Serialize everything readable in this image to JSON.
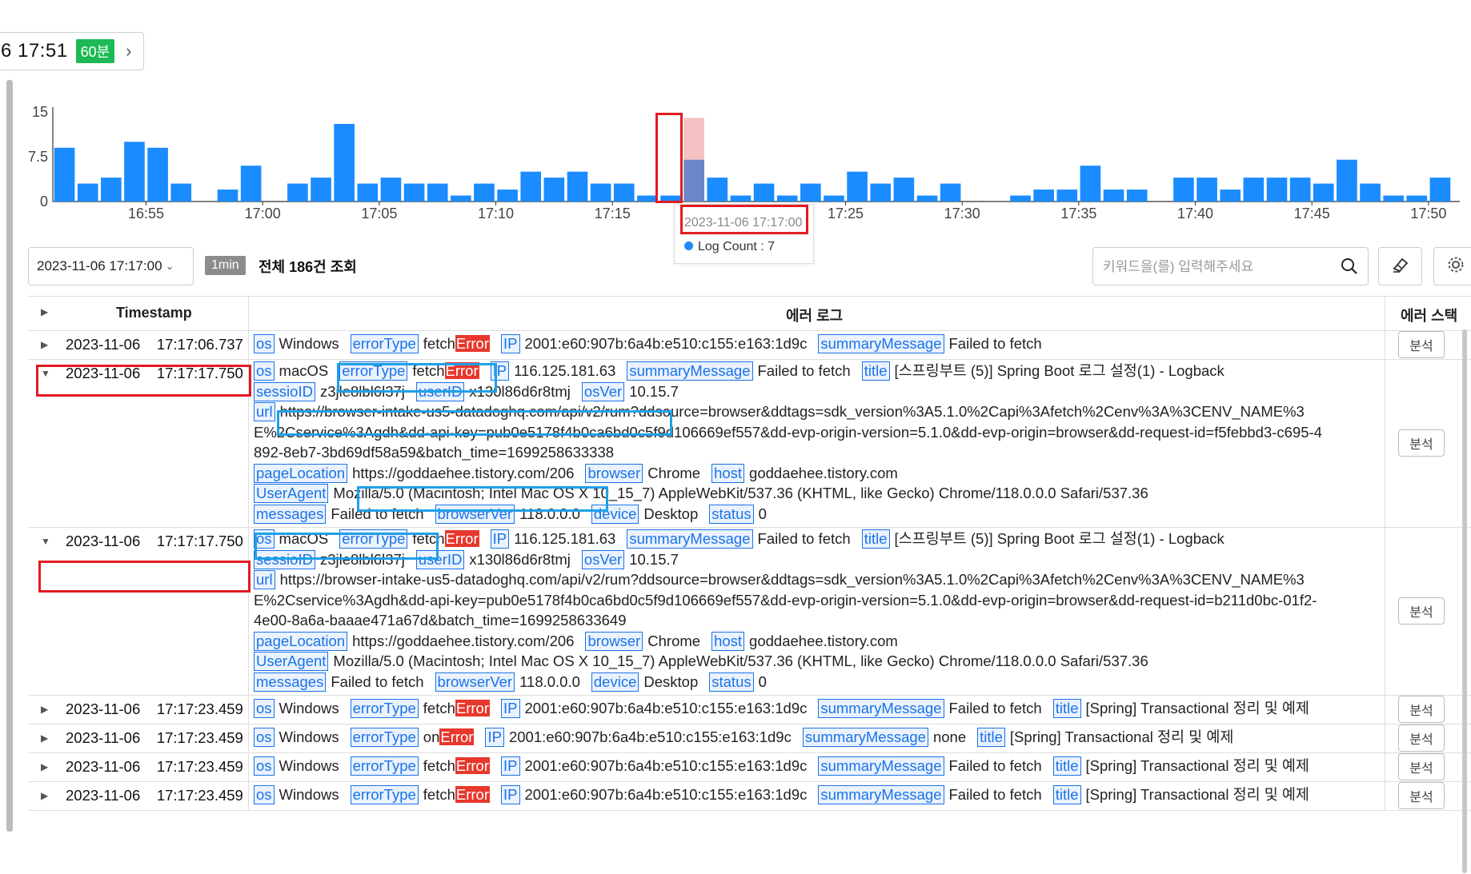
{
  "header": {
    "time": "6 17:51",
    "range_badge": "60분",
    "next_icon": "chevron-right-icon"
  },
  "chart_data": {
    "type": "bar",
    "yticks": [
      "15",
      "7.5",
      "0"
    ],
    "ylim": [
      0,
      15
    ],
    "xticks": [
      "16:55",
      "17:00",
      "17:05",
      "17:10",
      "17:15",
      "17:25",
      "17:30",
      "17:35",
      "17:40",
      "17:45",
      "17:50"
    ],
    "values": [
      9,
      3,
      4,
      10,
      9,
      3,
      0,
      2,
      6,
      0,
      3,
      4,
      13,
      3,
      4,
      3,
      3,
      1,
      3,
      2,
      5,
      4,
      5,
      3,
      3,
      1,
      1,
      7,
      4,
      1,
      3,
      1,
      3,
      1,
      5,
      3,
      4,
      1,
      3,
      0,
      0,
      1,
      2,
      2,
      6,
      2,
      2,
      0,
      4,
      4,
      2,
      4,
      4,
      4,
      3,
      7,
      3,
      1,
      1,
      4
    ],
    "highlight_index": 27,
    "highlight_extra": 7,
    "bar_color": "#1a8cff",
    "highlight_color": "#f3c1c1"
  },
  "tooltip": {
    "date": "2023-11-06 17:17:00",
    "label": "Log Count : 7"
  },
  "toolbar": {
    "date": "2023-11-06 17:17:00",
    "interval": "1min",
    "total": "전체 186건 조회",
    "search_placeholder": "키워드을(를) 입력해주세요"
  },
  "table": {
    "headers": {
      "timestamp": "Timestamp",
      "log": "에러 로그",
      "stack": "에러 스택"
    },
    "analyze_label": "분석",
    "rows": [
      {
        "ts": "2023-11-06    17:17:06.737",
        "lines": [
          [
            [
              "os",
              "Windows"
            ],
            [
              "errorType",
              "fetch|Error"
            ],
            [
              "IP",
              "2001:e60:907b:6a4b:e510:c155:e163:1d9c"
            ],
            [
              "summaryMessage",
              "Failed to fetch"
            ]
          ]
        ]
      },
      {
        "ts": "2023-11-06    17:17:17.750",
        "lines": [
          [
            [
              "os",
              "macOS"
            ],
            [
              "errorType",
              "fetch|Error"
            ],
            [
              "IP",
              "116.125.181.63"
            ],
            [
              "summaryMessage",
              "Failed to fetch"
            ],
            [
              "title",
              "[스프링부트 (5)] Spring Boot 로그 설정(1) - Logback"
            ]
          ],
          [
            [
              "sessioID",
              "z3jle8lbl6l37j"
            ],
            [
              "userID",
              "x130l86d6r8tmj"
            ],
            [
              "osVer",
              "10.15.7"
            ]
          ],
          [
            [
              "url",
              "https://browser-intake-us5-datadoghq.com/api/v2/rum?ddsource=browser&ddtags=sdk_version%3A5.1.0%2Capi%3Afetch%2Cenv%3A%3CENV_NAME%3"
            ]
          ],
          [
            [
              "",
              "E%2Cservice%3Agdh&dd-api-key=pub0e5178f4b0ca6bd0c5f9d106669ef557&dd-evp-origin-version=5.1.0&dd-evp-origin=browser&dd-request-id=f5febbd3-c695-4"
            ]
          ],
          [
            [
              "",
              "892-8eb7-3bd69df58a59&batch_time=1699258633338"
            ]
          ],
          [
            [
              "pageLocation",
              "https://goddaehee.tistory.com/206"
            ],
            [
              "browser",
              "Chrome"
            ],
            [
              "host",
              "goddaehee.tistory.com"
            ]
          ],
          [
            [
              "UserAgent",
              "Mozilla/5.0 (Macintosh; Intel Mac OS X 10_15_7) AppleWebKit/537.36 (KHTML, like Gecko) Chrome/118.0.0.0 Safari/537.36"
            ]
          ],
          [
            [
              "messages",
              "Failed to fetch"
            ],
            [
              "browserVer",
              "118.0.0.0"
            ],
            [
              "device",
              "Desktop"
            ],
            [
              "status",
              "0"
            ]
          ]
        ]
      },
      {
        "ts": "2023-11-06    17:17:17.750",
        "lines": [
          [
            [
              "os",
              "macOS"
            ],
            [
              "errorType",
              "fetch|Error"
            ],
            [
              "IP",
              "116.125.181.63"
            ],
            [
              "summaryMessage",
              "Failed to fetch"
            ],
            [
              "title",
              "[스프링부트 (5)] Spring Boot 로그 설정(1) - Logback"
            ]
          ],
          [
            [
              "sessioID",
              "z3jle8lbl6l37j"
            ],
            [
              "userID",
              "x130l86d6r8tmj"
            ],
            [
              "osVer",
              "10.15.7"
            ]
          ],
          [
            [
              "url",
              "https://browser-intake-us5-datadoghq.com/api/v2/rum?ddsource=browser&ddtags=sdk_version%3A5.1.0%2Capi%3Afetch%2Cenv%3A%3CENV_NAME%3"
            ]
          ],
          [
            [
              "",
              "E%2Cservice%3Agdh&dd-api-key=pub0e5178f4b0ca6bd0c5f9d106669ef557&dd-evp-origin-version=5.1.0&dd-evp-origin=browser&dd-request-id=b211d0bc-01f2-"
            ]
          ],
          [
            [
              "",
              "4e00-8a6a-baaae471a67d&batch_time=1699258633649"
            ]
          ],
          [
            [
              "pageLocation",
              "https://goddaehee.tistory.com/206"
            ],
            [
              "browser",
              "Chrome"
            ],
            [
              "host",
              "goddaehee.tistory.com"
            ]
          ],
          [
            [
              "UserAgent",
              "Mozilla/5.0 (Macintosh; Intel Mac OS X 10_15_7) AppleWebKit/537.36 (KHTML, like Gecko) Chrome/118.0.0.0 Safari/537.36"
            ]
          ],
          [
            [
              "messages",
              "Failed to fetch"
            ],
            [
              "browserVer",
              "118.0.0.0"
            ],
            [
              "device",
              "Desktop"
            ],
            [
              "status",
              "0"
            ]
          ]
        ]
      },
      {
        "ts": "2023-11-06    17:17:23.459",
        "lines": [
          [
            [
              "os",
              "Windows"
            ],
            [
              "errorType",
              "fetch|Error"
            ],
            [
              "IP",
              "2001:e60:907b:6a4b:e510:c155:e163:1d9c"
            ],
            [
              "summaryMessage",
              "Failed to fetch"
            ],
            [
              "title",
              "[Spring] Transactional 정리 및 예제"
            ]
          ]
        ]
      },
      {
        "ts": "2023-11-06    17:17:23.459",
        "lines": [
          [
            [
              "os",
              "Windows"
            ],
            [
              "errorType",
              "on|Error"
            ],
            [
              "IP",
              "2001:e60:907b:6a4b:e510:c155:e163:1d9c"
            ],
            [
              "summaryMessage",
              "none"
            ],
            [
              "title",
              "[Spring] Transactional 정리 및 예제"
            ]
          ]
        ]
      },
      {
        "ts": "2023-11-06    17:17:23.459",
        "lines": [
          [
            [
              "os",
              "Windows"
            ],
            [
              "errorType",
              "fetch|Error"
            ],
            [
              "IP",
              "2001:e60:907b:6a4b:e510:c155:e163:1d9c"
            ],
            [
              "summaryMessage",
              "Failed to fetch"
            ],
            [
              "title",
              "[Spring] Transactional 정리 및 예제"
            ]
          ]
        ]
      },
      {
        "ts": "2023-11-06    17:17:23.459",
        "lines": [
          [
            [
              "os",
              "Windows"
            ],
            [
              "errorType",
              "fetch|Error"
            ],
            [
              "IP",
              "2001:e60:907b:6a4b:e510:c155:e163:1d9c"
            ],
            [
              "summaryMessage",
              "Failed to fetch"
            ],
            [
              "title",
              "[Spring] Transactional 정리 및 예제"
            ]
          ]
        ]
      }
    ]
  }
}
